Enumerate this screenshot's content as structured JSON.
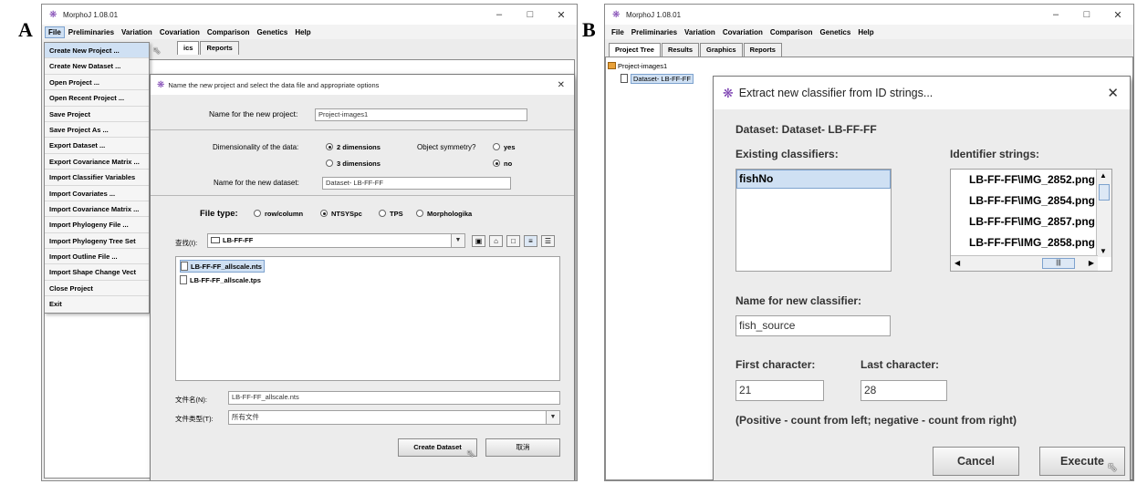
{
  "panel_a": {
    "letter": "A",
    "app_title": "MorphoJ 1.08.01",
    "menu": [
      "File",
      "Preliminaries",
      "Variation",
      "Covariation",
      "Comparison",
      "Genetics",
      "Help"
    ],
    "tabs_visible": [
      "ics",
      "Reports"
    ],
    "file_menu": [
      "Create New Project ...",
      "Create New Dataset ...",
      "Open Project ...",
      "Open Recent Project ...",
      "Save Project",
      "Save Project As ...",
      "Export Dataset ...",
      "Export Covariance Matrix ...",
      "Import Classifier Variables",
      "Import Covariates ...",
      "Import Covariance Matrix ...",
      "Import Phylogeny File ...",
      "Import Phylogeny Tree Set",
      "Import Outline File ...",
      "Import Shape Change Vect",
      "Close Project",
      "Exit"
    ],
    "dialog": {
      "title": "Name the new project and select the data file and appropriate options",
      "project_name_label": "Name for the new project:",
      "project_name_value": "Project-images1",
      "dimensionality_label": "Dimensionality of the data:",
      "dim_2": "2 dimensions",
      "dim_3": "3 dimensions",
      "symmetry_label": "Object symmetry?",
      "sym_yes": "yes",
      "sym_no": "no",
      "dataset_name_label": "Name for the new dataset:",
      "dataset_name_value": "Dataset- LB-FF-FF",
      "file_type_label": "File type:",
      "ft_rowcolumn": "row/column",
      "ft_ntsys": "NTSYSpc",
      "ft_tps": "TPS",
      "ft_morphologika": "Morphologika",
      "lookin_label": "查找(I):",
      "lookin_value": "LB-FF-FF",
      "files": [
        "LB-FF-FF_allscale.nts",
        "LB-FF-FF_allscale.tps"
      ],
      "filename_label": "文件名(N):",
      "filename_value": "LB-FF-FF_allscale.nts",
      "filetype_label": "文件类型(T):",
      "filetype_value": "所有文件",
      "create_button": "Create Dataset",
      "cancel_button": "取消"
    }
  },
  "panel_b": {
    "letter": "B",
    "app_title": "MorphoJ 1.08.01",
    "menu": [
      "File",
      "Preliminaries",
      "Variation",
      "Covariation",
      "Comparison",
      "Genetics",
      "Help"
    ],
    "tabs": [
      "Project Tree",
      "Results",
      "Graphics",
      "Reports"
    ],
    "tree_project": "Project-images1",
    "tree_dataset": "Dataset- LB-FF-FF",
    "dialog": {
      "title": "Extract new classifier from ID strings...",
      "dataset_label": "Dataset: Dataset- LB-FF-FF",
      "existing_label": "Existing classifiers:",
      "existing_items": [
        "fishNo"
      ],
      "identifier_label": "Identifier strings:",
      "identifier_items": [
        "LB-FF-FF\\IMG_2852.png",
        "LB-FF-FF\\IMG_2854.png",
        "LB-FF-FF\\IMG_2857.png",
        "LB-FF-FF\\IMG_2858.png"
      ],
      "new_name_label": "Name for new classifier:",
      "new_name_value": "fish_source",
      "first_label": "First character:",
      "first_value": "21",
      "last_label": "Last character:",
      "last_value": "28",
      "hint": "(Positive - count from left; negative - count from right)",
      "cancel_button": "Cancel",
      "execute_button": "Execute"
    }
  },
  "colors": {
    "selection": "#cfe0f3",
    "selection_border": "#7da2ce",
    "window_bg": "#ececec"
  }
}
